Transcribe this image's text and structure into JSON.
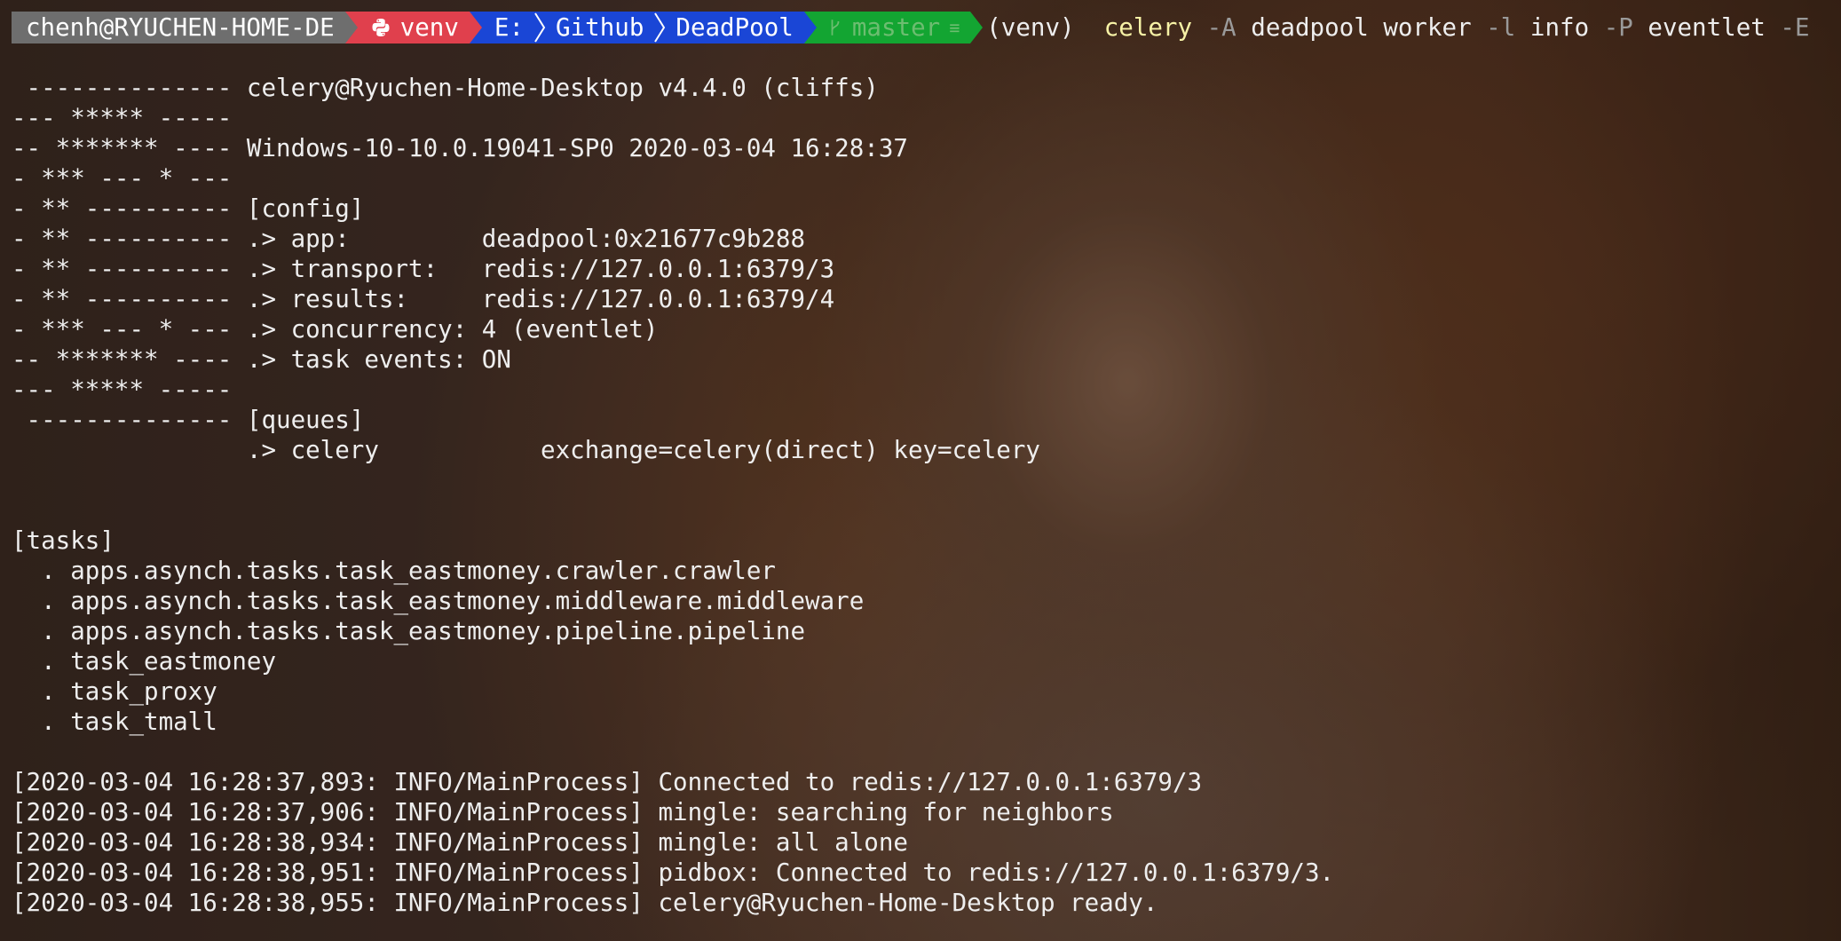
{
  "prompt": {
    "user_host": "chenh@RYUCHEN-HOME-DE",
    "venv": "venv",
    "path": [
      "E:",
      "Github",
      "DeadPool"
    ],
    "git_branch": "master",
    "git_status_glyph": "≡",
    "venv_prefix": "(venv)",
    "command": {
      "program": "celery",
      "flag_A": "-A",
      "app": "deadpool",
      "subcommand": "worker",
      "flag_l": "-l",
      "level": "info",
      "flag_P": "-P",
      "pool": "eventlet",
      "flag_E": "-E"
    }
  },
  "banner": [
    " -------------- celery@Ryuchen-Home-Desktop v4.4.0 (cliffs)",
    "--- ***** -----",
    "-- ******* ---- Windows-10-10.0.19041-SP0 2020-03-04 16:28:37",
    "- *** --- * ---",
    "- ** ---------- [config]",
    "- ** ---------- .> app:         deadpool:0x21677c9b288",
    "- ** ---------- .> transport:   redis://127.0.0.1:6379/3",
    "- ** ---------- .> results:     redis://127.0.0.1:6379/4",
    "- *** --- * --- .> concurrency: 4 (eventlet)",
    "-- ******* ---- .> task events: ON",
    "--- ***** -----",
    " -------------- [queues]",
    "                .> celery           exchange=celery(direct) key=celery"
  ],
  "tasks_header": "[tasks]",
  "tasks": [
    "  . apps.asynch.tasks.task_eastmoney.crawler.crawler",
    "  . apps.asynch.tasks.task_eastmoney.middleware.middleware",
    "  . apps.asynch.tasks.task_eastmoney.pipeline.pipeline",
    "  . task_eastmoney",
    "  . task_proxy",
    "  . task_tmall"
  ],
  "log": [
    "[2020-03-04 16:28:37,893: INFO/MainProcess] Connected to redis://127.0.0.1:6379/3",
    "[2020-03-04 16:28:37,906: INFO/MainProcess] mingle: searching for neighbors",
    "[2020-03-04 16:28:38,934: INFO/MainProcess] mingle: all alone",
    "[2020-03-04 16:28:38,951: INFO/MainProcess] pidbox: Connected to redis://127.0.0.1:6379/3.",
    "[2020-03-04 16:28:38,955: INFO/MainProcess] celery@Ryuchen-Home-Desktop ready."
  ],
  "colors": {
    "user_segment": "#6e6e6e",
    "venv_segment": "#e0404d",
    "path_segment": "#1a46d6",
    "git_segment": "#13a532",
    "command_highlight": "#f7f2a6",
    "flag_dim": "#9a9a9a",
    "text": "#eeeeee"
  },
  "icons": {
    "venv": "python-icon",
    "git": "git-branch-icon",
    "path_separator": "chevron-right-icon"
  }
}
